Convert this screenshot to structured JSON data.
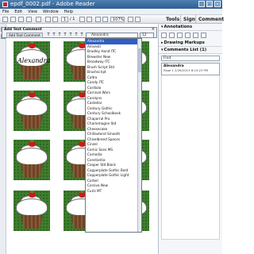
{
  "window": {
    "title": "epdf_0002.pdf - Adobe Reader",
    "min": "_",
    "max": "□",
    "close": "×"
  },
  "menu": [
    "File",
    "Edit",
    "View",
    "Window",
    "Help"
  ],
  "toolbar": {
    "page_current": "1",
    "page_total": "/ 1",
    "zoom": "107%",
    "tabs": [
      "Tools",
      "Sign",
      "Comment"
    ]
  },
  "comment_dialog": {
    "title": "Add Text Comment",
    "close": "×",
    "tab_label": "Add Text Comment",
    "format_buttons": [
      "T",
      "T",
      "T",
      "T",
      "T",
      "T",
      "T"
    ],
    "font_value": "Alexandra",
    "size_value": "12"
  },
  "font_list": {
    "items": [
      "Alexandra",
      "Amvesti",
      "Bradley Hand ITC",
      "Brewster New",
      "Broadway ITC",
      "Brush Script Std",
      "Brushscript",
      "Caltro",
      "Candy ITC",
      "Cardiola",
      "Carnival Wars",
      "Carolyns",
      "Castellar",
      "Century Gothic",
      "Century Schoolbook",
      "Chaparral Pro",
      "Charlemagne Std",
      "Cheesecake",
      "Chillaxtend Smooth",
      "Chiselbreed Spaces",
      "Cinzel",
      "Comic Sans MS",
      "Comedia",
      "Constantia",
      "Cooper Std Black",
      "Copperplate Gothic Bold",
      "Copperplate Gothic Light",
      "Corbel",
      "Corsiva New",
      "Curlz MT"
    ],
    "selected_index": 0
  },
  "document": {
    "name_label": "Alexandra"
  },
  "right_panel": {
    "annotations": "Annotations",
    "drawing_markups": "Drawing Markups",
    "comments_list": "Comments List (1)",
    "search_placeholder": "Find",
    "note_author": "Alexandra",
    "note_page": "Page 1  2/26/2013 6:15:23 PM"
  }
}
